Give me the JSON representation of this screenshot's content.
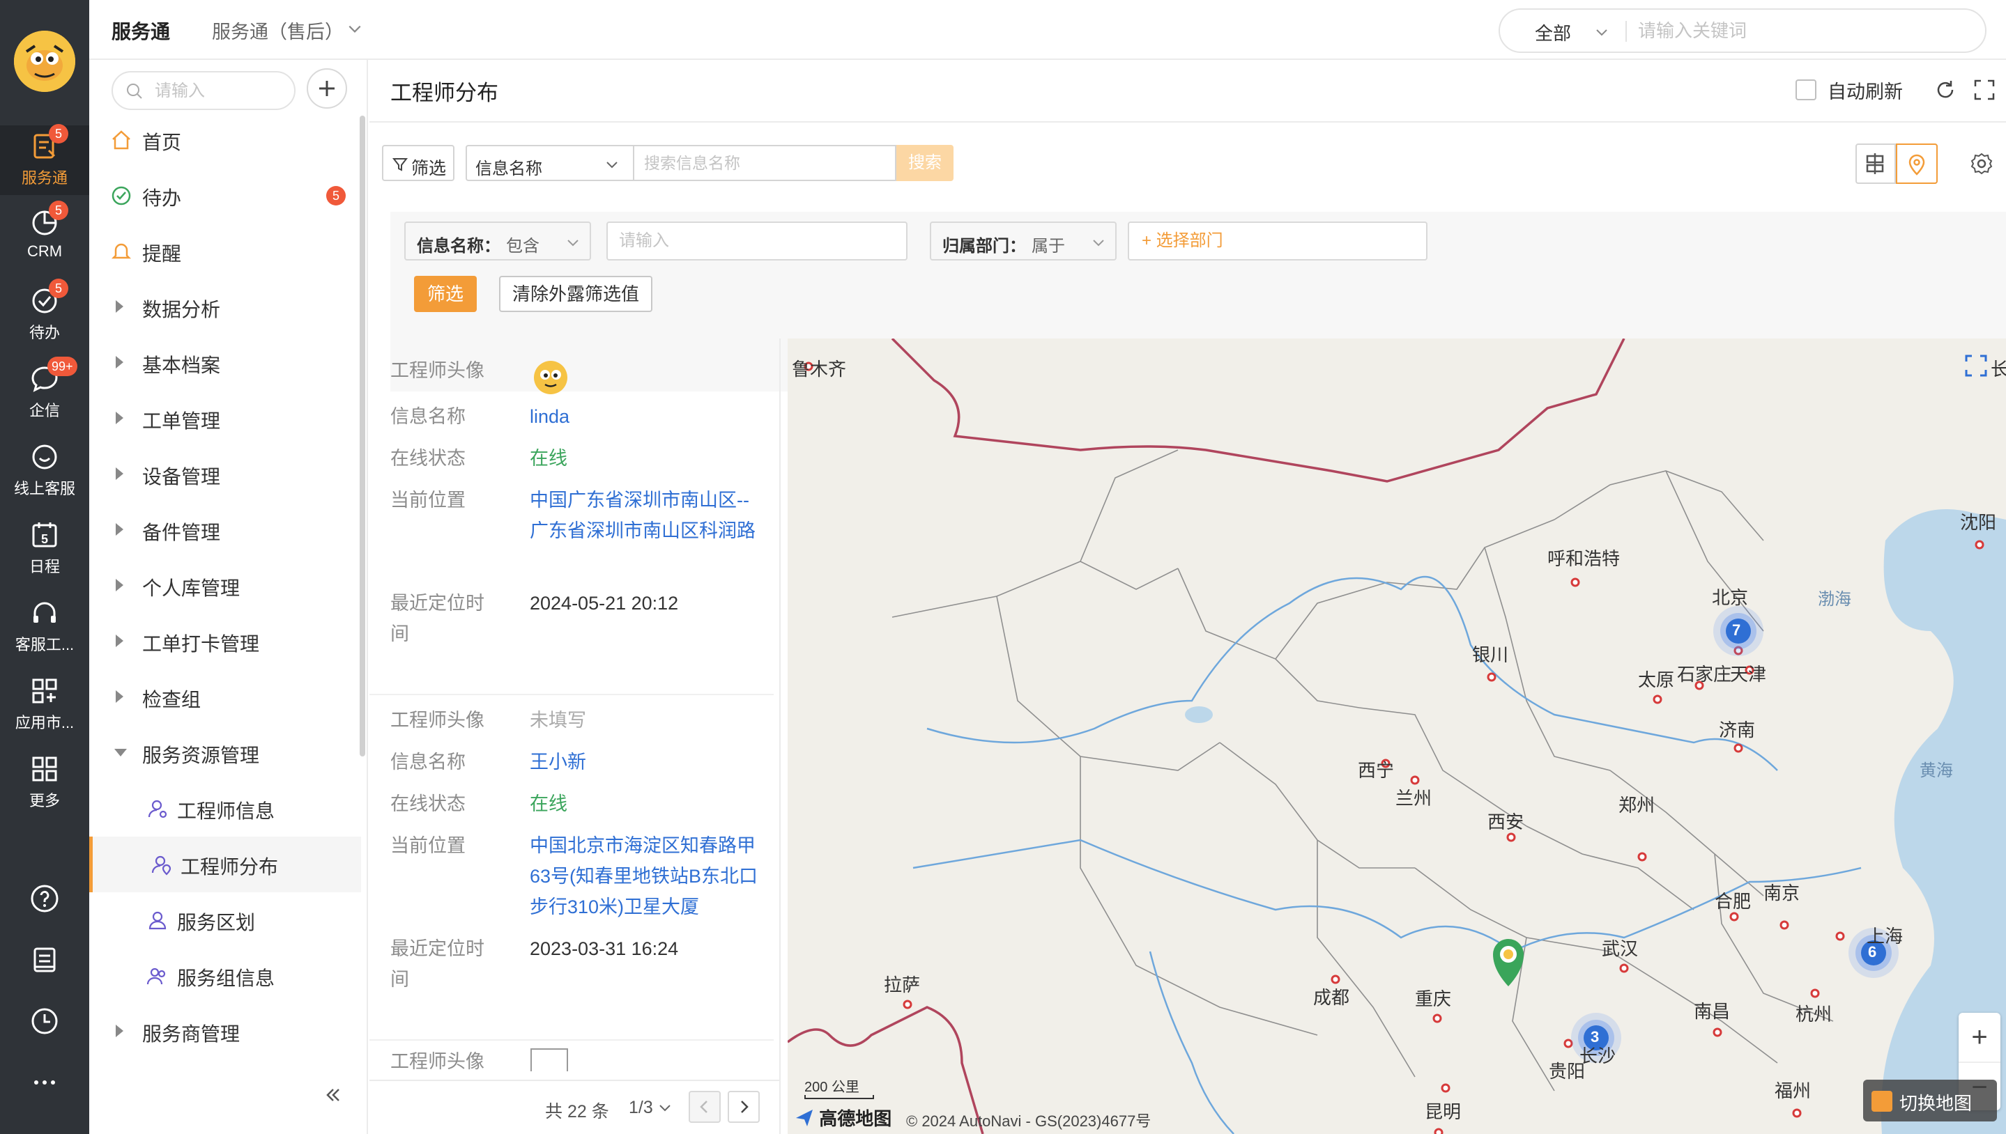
{
  "colors": {
    "accent": "#f39c38",
    "rail_bg": "#2f3338",
    "link": "#2f6fd4",
    "online": "#3ba55c",
    "badge": "#f0593a"
  },
  "rail": {
    "items": [
      {
        "label": "服务通",
        "icon": "service-icon",
        "badge": "5"
      },
      {
        "label": "CRM",
        "icon": "crm-icon",
        "badge": "5"
      },
      {
        "label": "待办",
        "icon": "check-circle-icon",
        "badge": "5"
      },
      {
        "label": "企信",
        "icon": "chat-icon",
        "badge": "99+"
      },
      {
        "label": "线上客服",
        "icon": "smile-chat-icon"
      },
      {
        "label": "日程",
        "icon": "calendar-icon",
        "day": "5"
      },
      {
        "label": "客服工...",
        "icon": "headset-icon"
      },
      {
        "label": "应用市...",
        "icon": "apps-icon"
      },
      {
        "label": "更多",
        "icon": "grid-icon"
      }
    ]
  },
  "topbar": {
    "app_name": "服务通",
    "sub_app": "服务通（售后）",
    "scope": "全部",
    "search_placeholder": "请输入关键词"
  },
  "nav": {
    "search_placeholder": "请输入",
    "items": [
      {
        "label": "首页"
      },
      {
        "label": "待办",
        "badge": "5"
      },
      {
        "label": "提醒"
      },
      {
        "label": "数据分析"
      },
      {
        "label": "基本档案"
      },
      {
        "label": "工单管理"
      },
      {
        "label": "设备管理"
      },
      {
        "label": "备件管理"
      },
      {
        "label": "个人库管理"
      },
      {
        "label": "工单打卡管理"
      },
      {
        "label": "检查组"
      },
      {
        "label": "服务资源管理"
      },
      {
        "label": "工程师信息"
      },
      {
        "label": "工程师分布"
      },
      {
        "label": "服务区划"
      },
      {
        "label": "服务组信息"
      },
      {
        "label": "服务商管理"
      }
    ]
  },
  "page": {
    "title": "工程师分布",
    "auto_refresh": "自动刷新",
    "filter_label": "筛选",
    "field_select": "信息名称",
    "search_placeholder": "搜索信息名称",
    "search_button": "搜索",
    "cond1_key": "信息名称：",
    "cond1_op": "包含",
    "cond1_placeholder": "请输入",
    "cond2_key": "归属部门：",
    "cond2_op": "属于",
    "cond2_pick": "+ 选择部门",
    "apply": "筛选",
    "clear": "清除外露筛选值"
  },
  "list": {
    "k_avatar": "工程师头像",
    "k_name": "信息名称",
    "k_status": "在线状态",
    "k_location": "当前位置",
    "k_time": "最近定位时间",
    "cards": [
      {
        "name": "linda",
        "status": "在线",
        "location": "中国广东省深圳市南山区--广东省深圳市南山区科润路",
        "time": "2024-05-21 20:12"
      },
      {
        "avatar_text": "未填写",
        "name": "王小新",
        "status": "在线",
        "location": "中国北京市海淀区知春路甲63号(知春里地铁站B东北口步行310米)卫星大厦",
        "time": "2023-03-31 16:24"
      }
    ],
    "total": "共 22 条",
    "page": "1/3"
  },
  "map": {
    "cities": [
      "鲁木齐",
      "呼和浩特",
      "北京",
      "沈阳",
      "银川",
      "太原",
      "石家庄",
      "天津",
      "济南",
      "西宁",
      "兰州",
      "西安",
      "郑州",
      "合肥",
      "南京",
      "上海",
      "拉萨",
      "成都",
      "武汉",
      "重庆",
      "杭州",
      "南昌",
      "长沙",
      "贵阳",
      "福州",
      "昆明",
      "长"
    ],
    "seas": [
      "渤海",
      "黄海"
    ],
    "clusters": [
      {
        "city": "北京",
        "count": "7"
      },
      {
        "city": "上海",
        "count": "6"
      },
      {
        "city": "长沙",
        "count": "3"
      }
    ],
    "scale": "200 公里",
    "logo": "高德地图",
    "copyright": "© 2024 AutoNavi - GS(2023)4677号",
    "switch": "切换地图",
    "zoom_in": "+",
    "zoom_out": "−"
  }
}
